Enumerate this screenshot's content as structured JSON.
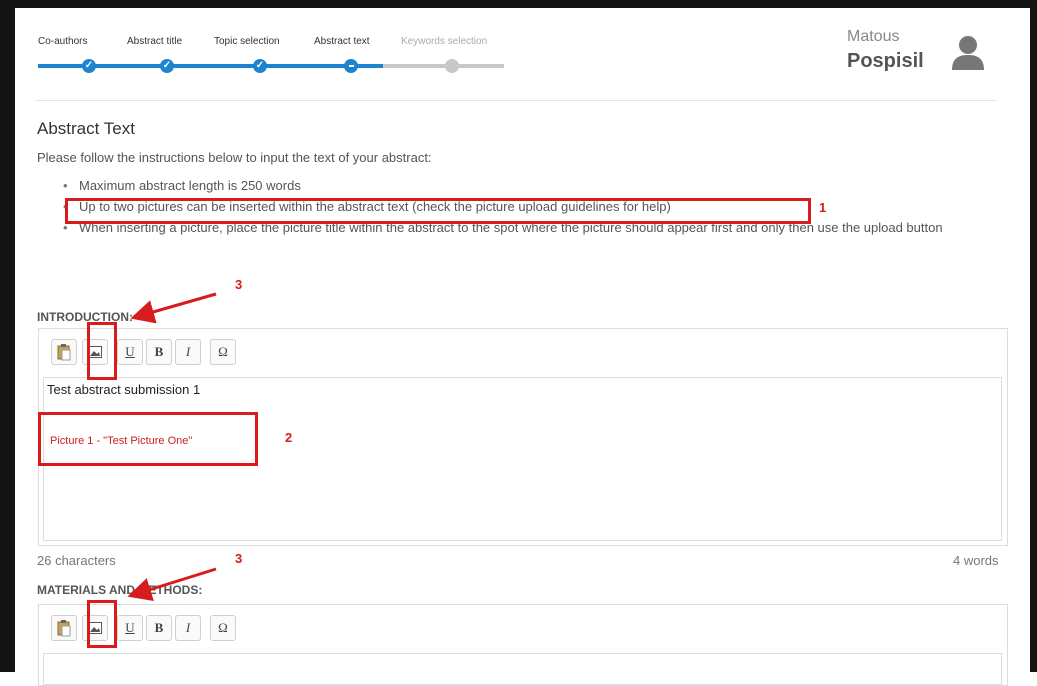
{
  "steps": [
    {
      "label": "Co-authors",
      "state": "done"
    },
    {
      "label": "Abstract title",
      "state": "done"
    },
    {
      "label": "Topic selection",
      "state": "done"
    },
    {
      "label": "Abstract text",
      "state": "current"
    },
    {
      "label": "Keywords selection",
      "state": "todo"
    }
  ],
  "user": {
    "first_name": "Matous",
    "last_name": "Pospisil"
  },
  "page": {
    "title": "Abstract Text",
    "instructions": "Please follow the instructions below to input the text of your abstract:",
    "rules": [
      "Maximum abstract length is 250 words",
      "Up to two pictures can be inserted within the abstract text (check the picture upload guidelines for help)",
      "When inserting a picture, place the picture title within the abstract to the spot where the picture should appear first and only then use the upload button"
    ]
  },
  "sections": {
    "introduction": {
      "label": "INTRODUCTION:",
      "text": "Test abstract submission 1",
      "picture_ref": "Picture 1 - \"Test Picture One\"",
      "char_count": "26 characters",
      "word_count": "4 words"
    },
    "methods": {
      "label": "MATERIALS AND METHODS:"
    }
  },
  "toolbar": {
    "underline": "U",
    "bold": "B",
    "italic": "I",
    "omega": "Ω"
  },
  "annotations": {
    "n1": "1",
    "n2": "2",
    "n3a": "3",
    "n3b": "3"
  },
  "colors": {
    "accent": "#1d84cf",
    "annotation": "#d61c1c",
    "picture_ref": "#cc1f1f"
  }
}
